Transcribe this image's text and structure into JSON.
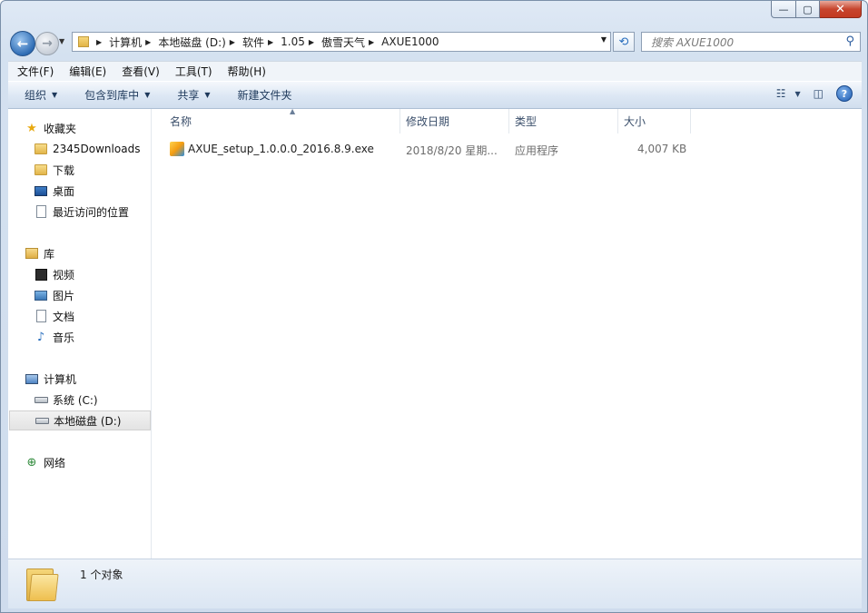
{
  "window": {
    "caption_buttons": {
      "minimize": "—",
      "maximize": "▢",
      "close": "✕"
    }
  },
  "nav": {
    "back_icon": "back-arrow-icon",
    "forward_icon": "forward-arrow-icon",
    "breadcrumb": [
      "计算机",
      "本地磁盘 (D:)",
      "软件",
      "1.05",
      "傲雪天气",
      "AXUE1000"
    ],
    "search_placeholder": "搜索 AXUE1000"
  },
  "menu": [
    "文件(F)",
    "编辑(E)",
    "查看(V)",
    "工具(T)",
    "帮助(H)"
  ],
  "toolbar": {
    "organize": "组织",
    "include_in_library": "包含到库中",
    "share": "共享",
    "new_folder": "新建文件夹"
  },
  "sidebar": {
    "favorites": {
      "label": "收藏夹",
      "items": [
        "2345Downloads",
        "下载",
        "桌面",
        "最近访问的位置"
      ]
    },
    "libraries": {
      "label": "库",
      "items": [
        "视频",
        "图片",
        "文档",
        "音乐"
      ]
    },
    "computer": {
      "label": "计算机",
      "items": [
        "系统 (C:)",
        "本地磁盘 (D:)"
      ],
      "selected": "本地磁盘 (D:)"
    },
    "network": {
      "label": "网络"
    }
  },
  "columns": {
    "name": "名称",
    "date": "修改日期",
    "type": "类型",
    "size": "大小"
  },
  "files": [
    {
      "name": "AXUE_setup_1.0.0.0_2016.8.9.exe",
      "date": "2018/8/20 星期...",
      "type": "应用程序",
      "size": "4,007 KB"
    }
  ],
  "status": {
    "text": "1 个对象"
  },
  "colors": {
    "accent": "#2a6fbe",
    "chrome": "#d4e1f0"
  }
}
